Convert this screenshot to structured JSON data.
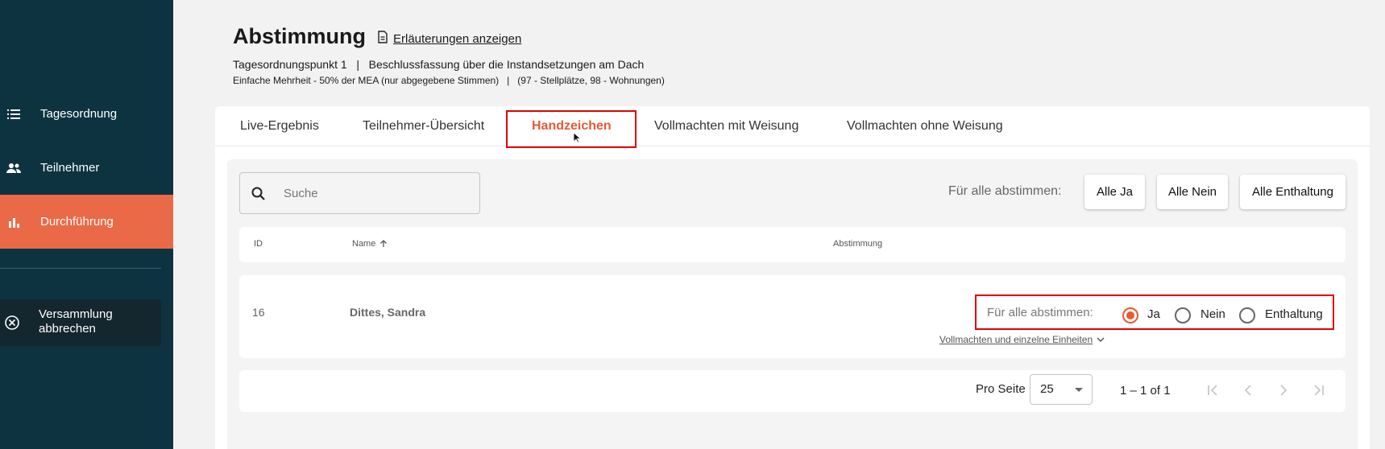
{
  "sidebar": {
    "items": [
      {
        "label": "Tagesordnung",
        "icon": "list-icon"
      },
      {
        "label": "Teilnehmer",
        "icon": "people-icon"
      },
      {
        "label": "Durchführung",
        "icon": "bar-chart-icon"
      }
    ],
    "abort_label": "Versammlung abbrechen",
    "active_color": "#ea6a47",
    "bg_color": "#0d3340"
  },
  "header": {
    "title": "Abstimmung",
    "explain_link": "Erläuterungen anzeigen",
    "agenda_line": "Tagesordnungspunkt 1   |   Beschlussfassung über die Instandsetzungen am Dach",
    "majority_line": "Einfache Mehrheit - 50% der MEA (nur abgegebene Stimmen)   |   (97 - Stellplätze, 98 - Wohnungen)"
  },
  "tabs": [
    {
      "label": "Live-Ergebnis"
    },
    {
      "label": "Teilnehmer-Übersicht"
    },
    {
      "label": "Handzeichen",
      "active": true
    },
    {
      "label": "Vollmachten mit Weisung"
    },
    {
      "label": "Vollmachten ohne Weisung"
    }
  ],
  "search": {
    "placeholder": "Suche",
    "value": ""
  },
  "vote_all": {
    "label": "Für alle abstimmen:",
    "buttons": {
      "yes": "Alle Ja",
      "no": "Alle Nein",
      "abstain": "Alle Enthaltung"
    }
  },
  "table": {
    "columns": {
      "id": "ID",
      "name": "Name",
      "vote": "Abstimmung"
    },
    "rows": [
      {
        "id": "16",
        "name": "Dittes, Sandra",
        "vote_label": "Für alle abstimmen:",
        "options": [
          "Ja",
          "Nein",
          "Enthaltung"
        ],
        "selected": "Ja",
        "proxy_link": "Vollmachten und einzelne Einheiten"
      }
    ]
  },
  "pagination": {
    "per_page_label": "Pro Seite",
    "per_page_value": "25",
    "range": "1 – 1 of 1"
  },
  "colors": {
    "accent": "#e55a35",
    "highlight_box": "#e00000"
  }
}
